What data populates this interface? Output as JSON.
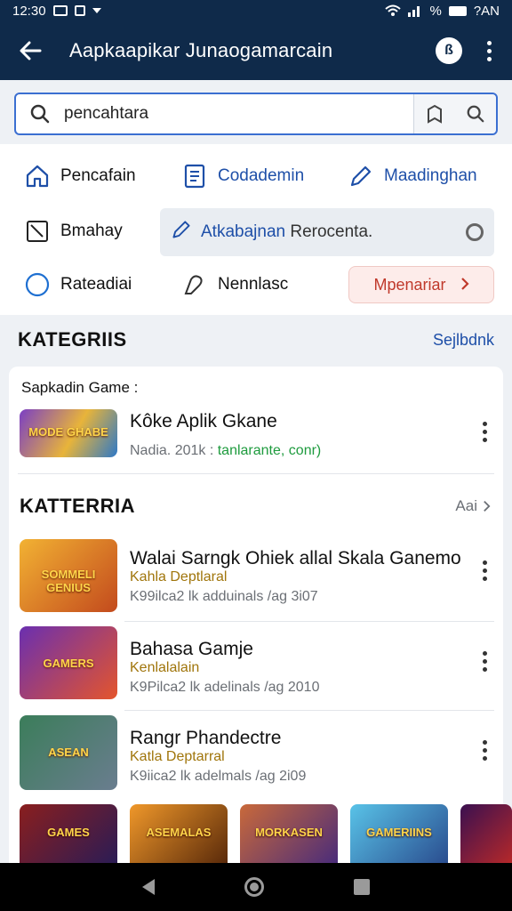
{
  "status": {
    "time": "12:30",
    "right_text": "%",
    "right_text2": "?AN"
  },
  "appbar": {
    "title": "Aapkaapikar Junaogamarcain",
    "badge": "ß"
  },
  "search": {
    "value": "pencahtara"
  },
  "quick": {
    "row1": [
      "Pencafain",
      "Codademin",
      "Maadinghan"
    ],
    "row2_left": "Bmahay",
    "search_chip": {
      "blue": "Atkabajnan",
      "gray": "Rerocenta."
    },
    "row3": [
      "Rateadiai",
      "Nennlasc"
    ],
    "button": "Mpenariar"
  },
  "section": {
    "title": "KATEGRIIS",
    "link": "Sejlbdnk"
  },
  "card": {
    "sub": "Sapkadin Game :",
    "featured": {
      "title": "Kôke Aplik Gkane",
      "meta_gray": "Nadia. 201k : ",
      "meta_green": "tanlarante, conr)",
      "thumb_label": "MODE GHABE"
    },
    "h2": "KATTERRIA",
    "seeall": "Aai",
    "items": [
      {
        "title": "Walai Sarngk Ohiek allal Skala Ganemo",
        "sub": "Kahla Deptlaral",
        "meta": "K99ilca2 lk adduinals /ag 3i07",
        "thumb_label": "SOMMELI GENIUS",
        "thumb": [
          "#f2b233",
          "#c34a1d"
        ]
      },
      {
        "title": "Bahasa Gamje",
        "sub": "Kenlalalain",
        "meta": "K9Pilca2 lk adelinals /ag 2010",
        "thumb_label": "GAMERS",
        "thumb": [
          "#6a2fb0",
          "#e4552c"
        ]
      },
      {
        "title": "Rangr Phandectre",
        "sub": "Katla Deptarral",
        "meta": "K9iica2 lk adelmals /ag 2i09",
        "thumb_label": "ASEAN",
        "thumb": [
          "#3b7d5a",
          "#6a7d8f"
        ]
      }
    ]
  },
  "bottom_thumbs": [
    {
      "label": "GAMES",
      "c1": "#8a1e1e",
      "c2": "#2b1c55"
    },
    {
      "label": "ASEMALAS",
      "c1": "#f0982a",
      "c2": "#5a2a0a"
    },
    {
      "label": "MORKASEN",
      "c1": "#c9693a",
      "c2": "#4a2c7a"
    },
    {
      "label": "GAMERIINS",
      "c1": "#59c3e8",
      "c2": "#2a4d8f"
    },
    {
      "label": "",
      "c1": "#3a1050",
      "c2": "#b5282a"
    }
  ],
  "colors": {
    "header": "#0f2a4a",
    "accent": "#1e4fa8",
    "red": "#c0392b",
    "green": "#1e9b3e"
  }
}
